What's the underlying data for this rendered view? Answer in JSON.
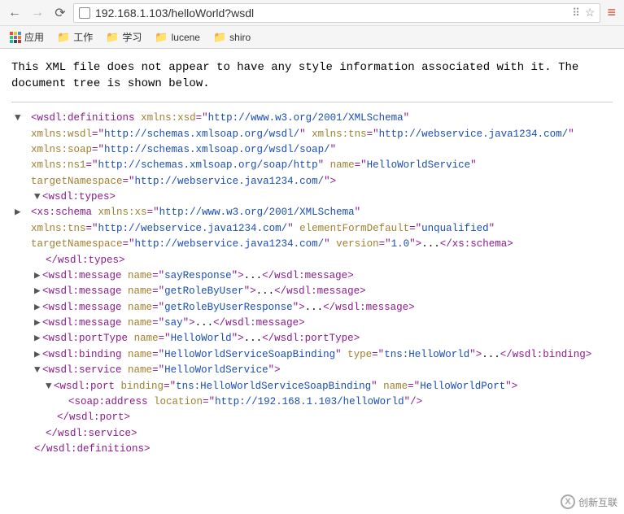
{
  "toolbar": {
    "url": "192.168.1.103/helloWorld?wsdl"
  },
  "bookmarks": {
    "apps_label": "应用",
    "items": [
      "工作",
      "学习",
      "lucene",
      "shiro"
    ]
  },
  "notice": "This XML file does not appear to have any style information associated with it. The document tree is shown below.",
  "xml": {
    "root_open_1": "wsdl:definitions",
    "attr_xmlns_xsd": "xmlns:xsd",
    "val_xmlns_xsd": "http://www.w3.org/2001/XMLSchema",
    "attr_xmlns_wsdl": "xmlns:wsdl",
    "val_xmlns_wsdl": "http://schemas.xmlsoap.org/wsdl/",
    "attr_xmlns_tns": "xmlns:tns",
    "val_xmlns_tns": "http://webservice.java1234.com/",
    "attr_xmlns_soap": "xmlns:soap",
    "val_xmlns_soap": "http://schemas.xmlsoap.org/wsdl/soap/",
    "attr_xmlns_ns1": "xmlns:ns1",
    "val_xmlns_ns1": "http://schemas.xmlsoap.org/soap/http",
    "attr_name": "name",
    "val_svc_name": "HelloWorldService",
    "attr_tns": "targetNamespace",
    "val_tns": "http://webservice.java1234.com/",
    "types_tag": "wsdl:types",
    "schema_tag": "xs:schema",
    "attr_xmlns_xs": "xmlns:xs",
    "val_xmlns_xs": "http://www.w3.org/2001/XMLSchema",
    "attr_xmlns_tns2": "xmlns:tns",
    "val_xmlns_tns2": "http://webservice.java1234.com/",
    "attr_efd": "elementFormDefault",
    "val_efd": "unqualified",
    "attr_tn2": "targetNamespace",
    "val_tn2": "http://webservice.java1234.com/",
    "attr_version": "version",
    "val_version": "1.0",
    "msg_tag": "wsdl:message",
    "msg1": "sayResponse",
    "msg2": "getRoleByUser",
    "msg3": "getRoleByUserResponse",
    "msg4": "say",
    "porttype_tag": "wsdl:portType",
    "porttype_name": "HelloWorld",
    "binding_tag": "wsdl:binding",
    "binding_name": "HelloWorldServiceSoapBinding",
    "attr_type": "type",
    "binding_type": "tns:HelloWorld",
    "service_tag": "wsdl:service",
    "service_name": "HelloWorldService",
    "port_tag": "wsdl:port",
    "attr_binding": "binding",
    "port_binding": "tns:HelloWorldServiceSoapBinding",
    "port_name": "HelloWorldPort",
    "addr_tag": "soap:address",
    "attr_location": "location",
    "addr_location": "http://192.168.1.103/helloWorld",
    "ellipsis": "..."
  },
  "watermark": "创新互联"
}
